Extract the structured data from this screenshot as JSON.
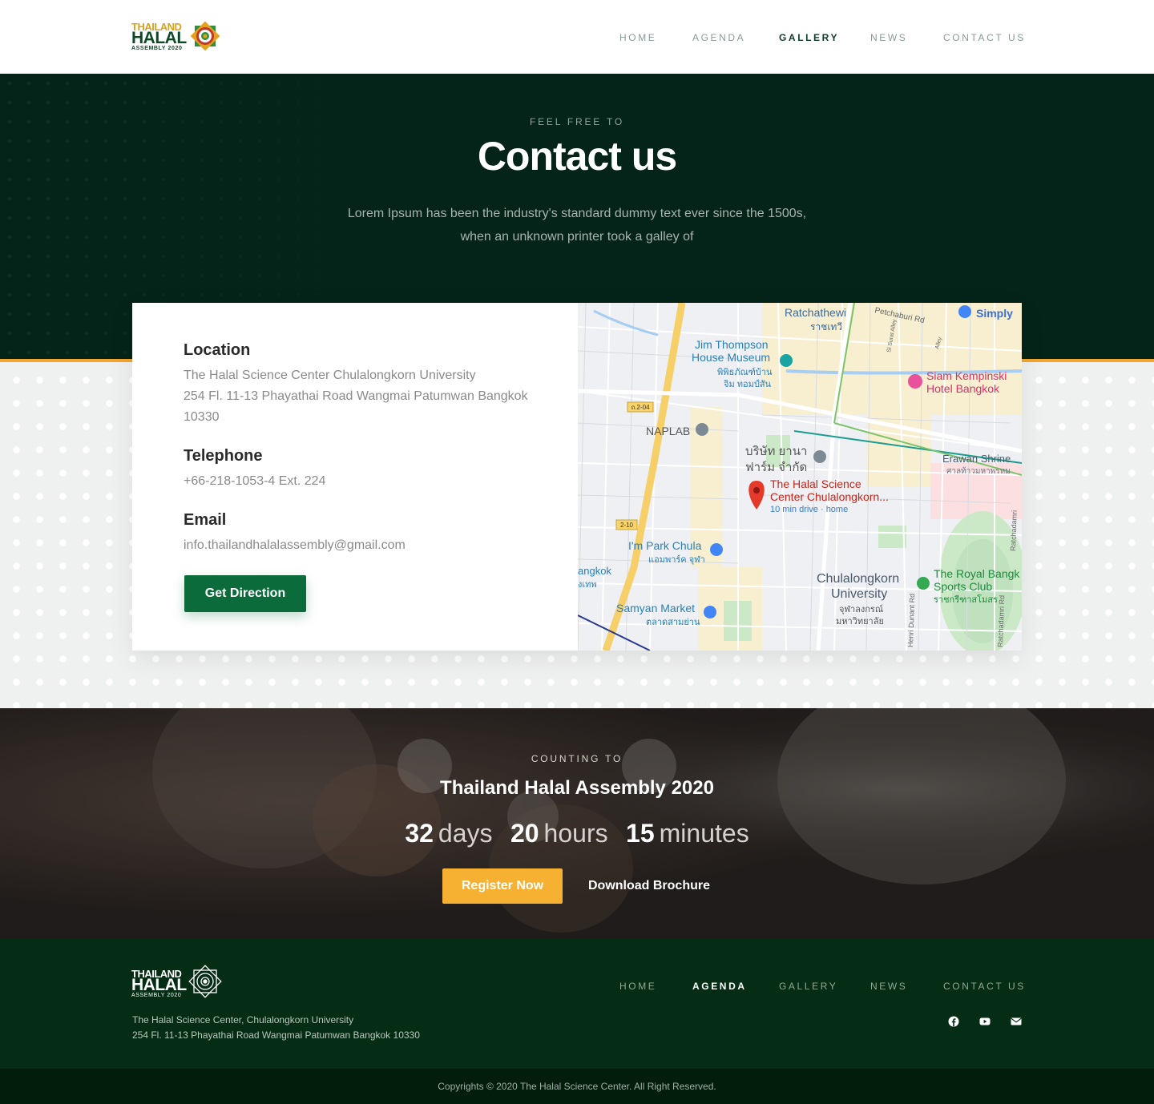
{
  "logo": {
    "line1": "THAILAND",
    "line2": "HALAL",
    "line3": "ASSEMBLY 2020"
  },
  "nav": {
    "items": [
      {
        "label": "HOME"
      },
      {
        "label": "AGENDA"
      },
      {
        "label": "GALLERY"
      },
      {
        "label": "NEWS"
      },
      {
        "label": "CONTACT US"
      }
    ],
    "active": "GALLERY"
  },
  "hero": {
    "eyebrow": "FEEL FREE TO",
    "title": "Contact us",
    "subtitle": "Lorem Ipsum has been the industry's standard dummy text ever since the 1500s, when an unknown printer took a galley of"
  },
  "contact": {
    "location_label": "Location",
    "location_line1": "The Halal Science Center Chulalongkorn University",
    "location_line2": "254 Fl. 11-13 Phayathai Road Wangmai Patumwan Bangkok",
    "location_line3": "10330",
    "telephone_label": "Telephone",
    "telephone": "+66-218-1053-4 Ext. 224",
    "email_label": "Email",
    "email": "info.thailandhalalassembly@gmail.com",
    "button": "Get Direction"
  },
  "map": {
    "labels": {
      "ratchathewi": "Ratchathewi",
      "ratchathewi_th": "ราชเทวี",
      "petchaburi": "Petchaburi Rd",
      "simply": "Simply",
      "jim1": "Jim Thompson",
      "jim2": "House Museum",
      "jim_th1": "พิพิธภัณฑ์บ้าน",
      "jim_th2": "จิม ทอมป์สัน",
      "siam1": "Siam Kempinski",
      "siam2": "Hotel Bangkok",
      "road204": "ถ.2-04",
      "naplab": "NAPLAB",
      "yana1": "บริษัท ยานา",
      "yana2": "ฟาร์ม จำกัด",
      "erawan": "Erawan Shrine",
      "erawan_th": "ศาลท้าวมหาพรหม",
      "halal1": "The Halal Science",
      "halal2": "Center Chulalongkorn...",
      "halal3": "10 min drive · home",
      "road210": "2-10",
      "impark": "I'm Park Chula",
      "impark_th": "แอมพาร์ค จุฬา",
      "angkok": "angkok",
      "angkok_th": "งเทพ",
      "chula1": "Chulalongkorn",
      "chula2": "University",
      "chula_th1": "จุฬาลงกรณ์",
      "chula_th2": "มหาวิทยาลัย",
      "royal1": "The Royal Bangk",
      "royal2": "Sports Club",
      "royal_th": "ราชกรีฑาสโมสร",
      "samyan": "Samyan Market",
      "samyan_th": "ตลาดสามย่าน",
      "henri": "Henri Dunant Rd",
      "ratchadamri": "Ratchadamri Rd",
      "ratchadamri2": "Ratchadamri",
      "surat": "Si Surat Alley",
      "alley": "Alley"
    }
  },
  "countdown": {
    "eyebrow": "COUNTING TO",
    "title": "Thailand Halal Assembly 2020",
    "days": "32",
    "days_unit": "days",
    "hours": "20",
    "hours_unit": "hours",
    "minutes": "15",
    "minutes_unit": "minutes",
    "register": "Register Now",
    "brochure": "Download Brochure"
  },
  "footer": {
    "nav": [
      {
        "label": "HOME"
      },
      {
        "label": "AGENDA"
      },
      {
        "label": "GALLERY"
      },
      {
        "label": "NEWS"
      },
      {
        "label": "CONTACT US"
      }
    ],
    "active": "AGENDA",
    "address1": "The Halal Science Center, Chulalongkorn University",
    "address2": "254 Fl. 11-13 Phayathai Road Wangmai Patumwan Bangkok 10330",
    "socials": [
      "facebook-icon",
      "youtube-icon",
      "email-icon"
    ],
    "copyright": "Copyrights © 2020 The Halal Science Center. All Right Reserved."
  },
  "colors": {
    "brand_green": "#0c6b3a",
    "hero_bg": "#052419",
    "accent_orange": "#f2a630",
    "register_yellow": "#f6b133",
    "footer_bg": "#052c14"
  }
}
